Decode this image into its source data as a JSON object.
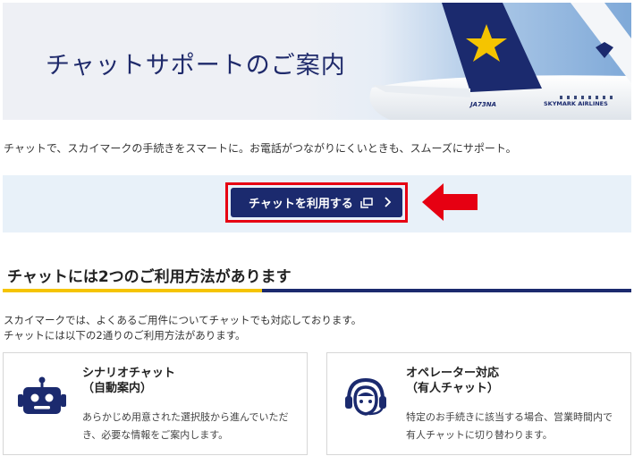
{
  "hero": {
    "title": "チャットサポートのご案内",
    "plane_registration": "JA73NA",
    "plane_livery": "SKYMARK AIRLINES"
  },
  "intro_text": "チャットで、スカイマークの手続きをスマートに。お電話がつながりにくいときも、スムーズにサポート。",
  "cta": {
    "label": "チャットを利用する",
    "external_icon": "external-window-icon",
    "chevron_icon": "chevron-right-icon",
    "highlight_color": "#e60012",
    "button_color": "#1b2a6e"
  },
  "section": {
    "title": "チャットには2つのご利用方法があります",
    "desc_line1": "スカイマークでは、よくあるご用件についてチャットでも対応しております。",
    "desc_line2": "チャットには以下の2通りのご利用方法があります。"
  },
  "cards": [
    {
      "icon": "robot-icon",
      "title_line1": "シナリオチャット",
      "title_line2": "（自動案内）",
      "body_line1": "あらかじめ用意された選択肢から進んでいただ",
      "body_line2": "き、必要な情報をご案内します。"
    },
    {
      "icon": "headset-operator-icon",
      "title_line1": "オペレーター対応",
      "title_line2": "（有人チャット）",
      "body_line1": "特定のお手続きに該当する場合、営業時間内で",
      "body_line2": "有人チャットに切り替わります。"
    }
  ]
}
